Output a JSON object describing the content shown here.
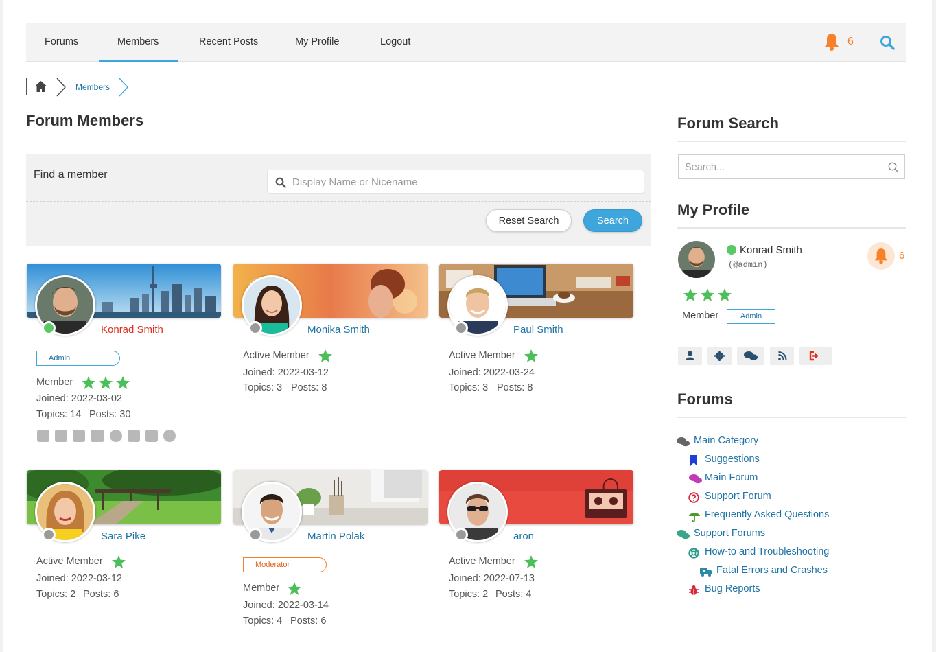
{
  "nav": {
    "items": [
      {
        "label": "Forums"
      },
      {
        "label": "Members"
      },
      {
        "label": "Recent Posts"
      },
      {
        "label": "My Profile"
      },
      {
        "label": "Logout"
      }
    ],
    "active": "Members",
    "notification_count": "6",
    "accent": "#3ea6dd",
    "bell_color": "#f7812a"
  },
  "breadcrumb": {
    "home_icon": "home-icon",
    "current": "Members"
  },
  "page": {
    "title": "Forum Members"
  },
  "finder": {
    "label": "Find a member",
    "placeholder": "Display Name or Nicename",
    "reset_label": "Reset Search",
    "search_label": "Search"
  },
  "members": [
    {
      "name": "Konrad Smith",
      "status": "online",
      "badge": "Admin",
      "role": "Member",
      "stars": 3,
      "joined": "Joined: 2022-03-02",
      "topics": "Topics: 14",
      "posts": "Posts: 30",
      "social": [
        "linkedin-icon",
        "instagram-icon",
        "vk-icon",
        "youtube-icon",
        "telegram-icon",
        "facebook-icon",
        "twitter-icon",
        "skype-icon"
      ]
    },
    {
      "name": "Monika Smith",
      "status": "offline",
      "role": "Active Member",
      "stars": 1,
      "joined": "Joined: 2022-03-12",
      "topics": "Topics: 3",
      "posts": "Posts: 8"
    },
    {
      "name": "Paul Smith",
      "status": "offline",
      "role": "Active Member",
      "stars": 1,
      "joined": "Joined: 2022-03-24",
      "topics": "Topics: 3",
      "posts": "Posts: 8"
    },
    {
      "name": "Sara Pike",
      "status": "offline",
      "role": "Active Member",
      "stars": 1,
      "joined": "Joined: 2022-03-12",
      "topics": "Topics: 2",
      "posts": "Posts: 6"
    },
    {
      "name": "Martin Polak",
      "status": "offline",
      "badge": "Moderator",
      "role": "Member",
      "stars": 1,
      "joined": "Joined: 2022-03-14",
      "topics": "Topics: 4",
      "posts": "Posts: 6"
    },
    {
      "name": "aron",
      "status": "offline",
      "role": "Active Member",
      "stars": 1,
      "joined": "Joined: 2022-07-13",
      "topics": "Topics: 2",
      "posts": "Posts: 4"
    }
  ],
  "sidebar": {
    "search_title": "Forum Search",
    "search_placeholder": "Search...",
    "profile_title": "My Profile",
    "profile": {
      "name": "Konrad Smith",
      "handle": "(@admin)",
      "notification_count": "6",
      "stars": 3,
      "role": "Member",
      "badge": "Admin",
      "tools": [
        "user-icon",
        "gear-icon",
        "comments-icon",
        "rss-icon",
        "sign-out-icon"
      ]
    },
    "forums_title": "Forums",
    "forums": [
      {
        "label": "Main Category",
        "icon": "comments-icon",
        "color": "#666666"
      },
      {
        "label": "Suggestions",
        "icon": "bookmark-icon",
        "color": "#1e3fd6"
      },
      {
        "label": "Main Forum",
        "icon": "comments-icon",
        "color": "#c03bb5"
      },
      {
        "label": "Support Forum",
        "icon": "question-circle-icon",
        "color": "#d62a3a"
      },
      {
        "label": "Frequently Asked Questions",
        "icon": "umbrella-icon",
        "color": "#4a9a2e"
      },
      {
        "label": "Support Forums",
        "icon": "comments-icon",
        "color": "#3aa58a"
      },
      {
        "label": "How-to and Troubleshooting",
        "icon": "life-ring-icon",
        "color": "#2a9a8a"
      },
      {
        "label": "Fatal Errors and Crashes",
        "icon": "truck-icon",
        "color": "#2a8aa8"
      },
      {
        "label": "Bug Reports",
        "icon": "bug-icon",
        "color": "#d62a3a"
      }
    ]
  }
}
